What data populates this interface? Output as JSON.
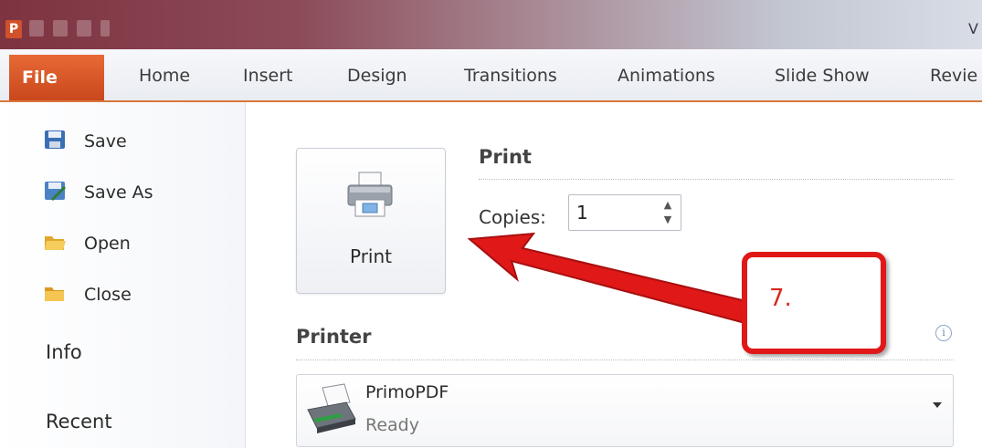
{
  "app": {
    "logo_letter": "P",
    "window_title_fragment": "V"
  },
  "ribbon": {
    "file_tab": "File",
    "tabs": [
      "Home",
      "Insert",
      "Design",
      "Transitions",
      "Animations",
      "Slide Show",
      "Revie"
    ]
  },
  "backstage_nav": {
    "items": [
      {
        "label": "Save",
        "icon": "save-icon"
      },
      {
        "label": "Save As",
        "icon": "save-as-icon"
      },
      {
        "label": "Open",
        "icon": "open-folder-icon"
      },
      {
        "label": "Close",
        "icon": "close-folder-icon"
      }
    ],
    "info_label": "Info",
    "recent_label": "Recent"
  },
  "print": {
    "button_label": "Print",
    "section_title": "Print",
    "copies_label": "Copies:",
    "copies_value": "1"
  },
  "printer": {
    "section_title": "Printer",
    "info_glyph": "i",
    "name": "PrimoPDF",
    "status": "Ready"
  },
  "annotation": {
    "step_label": "7.",
    "color": "#e01818"
  },
  "colors": {
    "file_tab": "#d9551f",
    "accent_line": "#d9783a"
  }
}
